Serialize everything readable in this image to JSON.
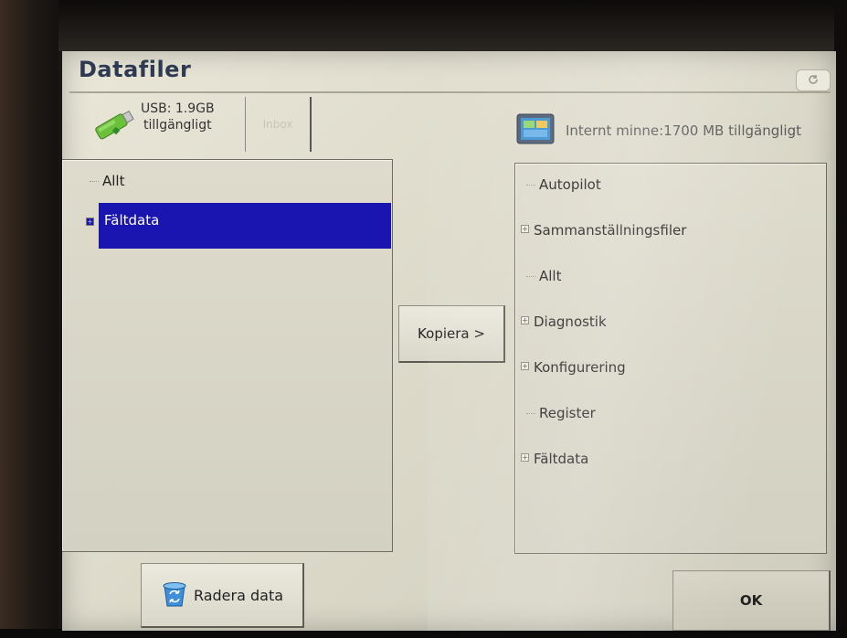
{
  "window": {
    "title": "Datafiler"
  },
  "source": {
    "usb_line1": "USB: 1.9GB",
    "usb_line2": "tillgängligt",
    "inbox_label": "Inbox",
    "items": [
      {
        "label": "Allt",
        "expandable": false
      },
      {
        "label": "Fältdata",
        "expandable": true,
        "selected": true
      }
    ]
  },
  "destination": {
    "header": "Internt minne:1700 MB tillgängligt",
    "items": [
      {
        "label": "Autopilot",
        "expandable": false
      },
      {
        "label": "Sammanställningsfiler",
        "expandable": true
      },
      {
        "label": "Allt",
        "expandable": false
      },
      {
        "label": "Diagnostik",
        "expandable": true
      },
      {
        "label": "Konfigurering",
        "expandable": true
      },
      {
        "label": "Register",
        "expandable": false
      },
      {
        "label": "Fältdata",
        "expandable": true
      }
    ]
  },
  "buttons": {
    "copy": "Kopiera >",
    "delete": "Radera data",
    "ok": "OK"
  },
  "colors": {
    "selection": "#1a14b0",
    "title": "#2e3a52",
    "panel": "#d8d6c7"
  },
  "icons": {
    "usb": "usb-drive-icon",
    "internal": "internal-memory-icon",
    "delete": "recycle-bin-icon",
    "refresh": "refresh-icon",
    "expand": "plus-expander-icon"
  }
}
